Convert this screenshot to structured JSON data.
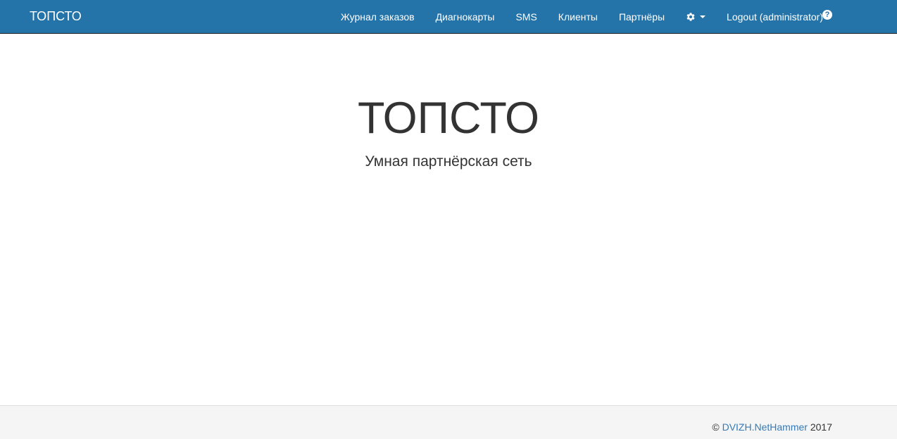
{
  "navbar": {
    "brand": "ТОПСТО",
    "items": [
      {
        "label": "Журнал заказов"
      },
      {
        "label": "Диагнокарты"
      },
      {
        "label": "SMS"
      },
      {
        "label": "Клиенты"
      },
      {
        "label": "Партнёры"
      }
    ],
    "settings_icon": "gear-icon",
    "logout_label": "Logout (administrator)",
    "help_icon": "question-circle-icon",
    "help_glyph": "?",
    "background_color": "#2574a9"
  },
  "hero": {
    "title": "ТОПСТО",
    "subtitle": "Умная партнёрская сеть"
  },
  "footer": {
    "copyright": "©",
    "company_link": "DVIZH.NetHammer",
    "year": "2017",
    "link_color": "#337ab7"
  }
}
